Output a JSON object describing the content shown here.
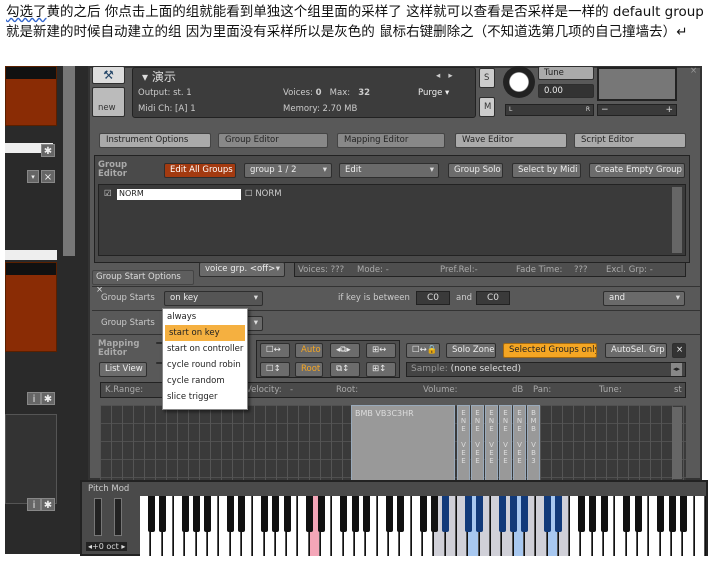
{
  "caption": {
    "underlined": "勾选了",
    "line": "黄的之后 你点击上面的组就能看到单独这个组里面的采样了 这样就可以查看是否采样是一样的 default group 就是新建的时候自动建立的组 因为里面没有采样所以是灰色的 鼠标右键删除之（不知道选第几项的自己撞墙去）↵"
  },
  "header": {
    "instrument": "演示",
    "output_label": "Output:",
    "output": "st. 1",
    "midi_label": "Midi Ch:",
    "midi": "[A] 1",
    "voices_label": "Voices:",
    "voices": "0",
    "max_label": "Max:",
    "max": "32",
    "purge": "Purge",
    "memory_label": "Memory:",
    "memory": "2.70 MB",
    "new": "new",
    "s": "S",
    "m": "M",
    "tune_label": "Tune",
    "tune": "0.00",
    "pan_l": "L",
    "pan_r": "R",
    "vol_minus": "−",
    "vol_plus": "+"
  },
  "tabs": [
    "Instrument Options",
    "Group Editor",
    "Mapping Editor",
    "Wave Editor",
    "Script Editor"
  ],
  "group_editor": {
    "title": "Group Editor",
    "edit_all": "Edit All Groups",
    "group_select": "group 1 / 2",
    "edit": "Edit",
    "group_solo": "Group Solo",
    "select_midi": "Select by Midi",
    "create_empty": "Create Empty Group",
    "groups": [
      "NORM",
      "NORM"
    ],
    "voice_grp": "voice grp. <off>",
    "voices": "Voices: ???",
    "mode": "Mode: -",
    "pref_rel": "Pref.Rel:-",
    "fade_time": "Fade Time:",
    "fade_val": "???",
    "excl": "Excl. Grp: -"
  },
  "start_options": {
    "tab": "Group Start Options ×",
    "row_label": "Group Starts",
    "value": "on key",
    "between": "if key is between",
    "low": "C0",
    "and_label": "and",
    "high": "C0",
    "logic": "and",
    "row2_label": "Group Starts",
    "menu": [
      "always",
      "start on key",
      "start on controller",
      "cycle round robin",
      "cycle random",
      "slice trigger"
    ]
  },
  "mapping": {
    "title": "Mapping Editor",
    "list_view": "List View",
    "auto": "Auto",
    "root": "Root",
    "solo_zone": "Solo Zone",
    "selected_groups": "Selected Groups only",
    "autosel": "AutoSel. Grp",
    "close": "×",
    "sample_label": "Sample:",
    "sample": "(none selected)",
    "cols": [
      "K.Range:",
      "Velocity:",
      "-",
      "Root:",
      "Volume:",
      "dB",
      "Pan:",
      "Tune:",
      "st"
    ],
    "zone_label": "BMB VB3C3HR",
    "zone_cols": [
      "E N E  V E E",
      "E N E  V E E",
      "E N E  V E E",
      "E N E  V E E",
      "E N E  V E E",
      "B M B  V B 3"
    ]
  },
  "keyboard": {
    "label": "Pitch Mod",
    "octave": "◂+0 oct ▸",
    "white_keys": 50,
    "pressed_key": 15,
    "range_start": 26,
    "range_end": 37,
    "blue_keys": [
      29,
      33,
      36
    ],
    "colors": {
      "pressed": "#f4a6b8",
      "range": "#d0d0d8",
      "blue": "#a8c8f0"
    }
  }
}
